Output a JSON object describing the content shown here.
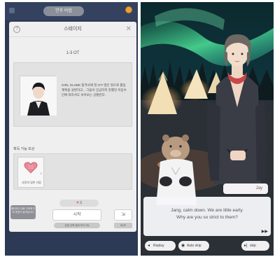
{
  "left_screen": {
    "topbar": {
      "pill_text": "연주 비법"
    },
    "modal": {
      "help_icon": "?",
      "title": "스테이지",
      "close_icon": "✕",
      "stage_id": "1-3 OT",
      "story_text": "GIRL GLOBE 합격사에 첫 OT! 맹은 렁으로 활동 계획을 설명하고... 그들이 궁금하지 못했던 이동수단에 따라서도 서어보는 상황한다.",
      "reward_label": "획득 가능 보상",
      "reward_item": {
        "name": "사랑의 일반 사탕",
        "count": "1"
      },
      "hint_text": "챕터마다 대화 선택에 따라 엔딩이 달라집니다",
      "heart_cost": "3",
      "start_label": "시작",
      "auto_label": "감정 선택 결과 보기 ON",
      "skip_label": "SKIP"
    }
  },
  "right_screen": {
    "speaker": "Jay",
    "dialog_line1": "Jang, calm down. We are little early.",
    "dialog_line2": "Why are you so strict to them?",
    "next_indicator": "▶▶",
    "controls": {
      "replay": "Replay",
      "auto_skip": "Auto skip",
      "skip": "skip"
    }
  }
}
